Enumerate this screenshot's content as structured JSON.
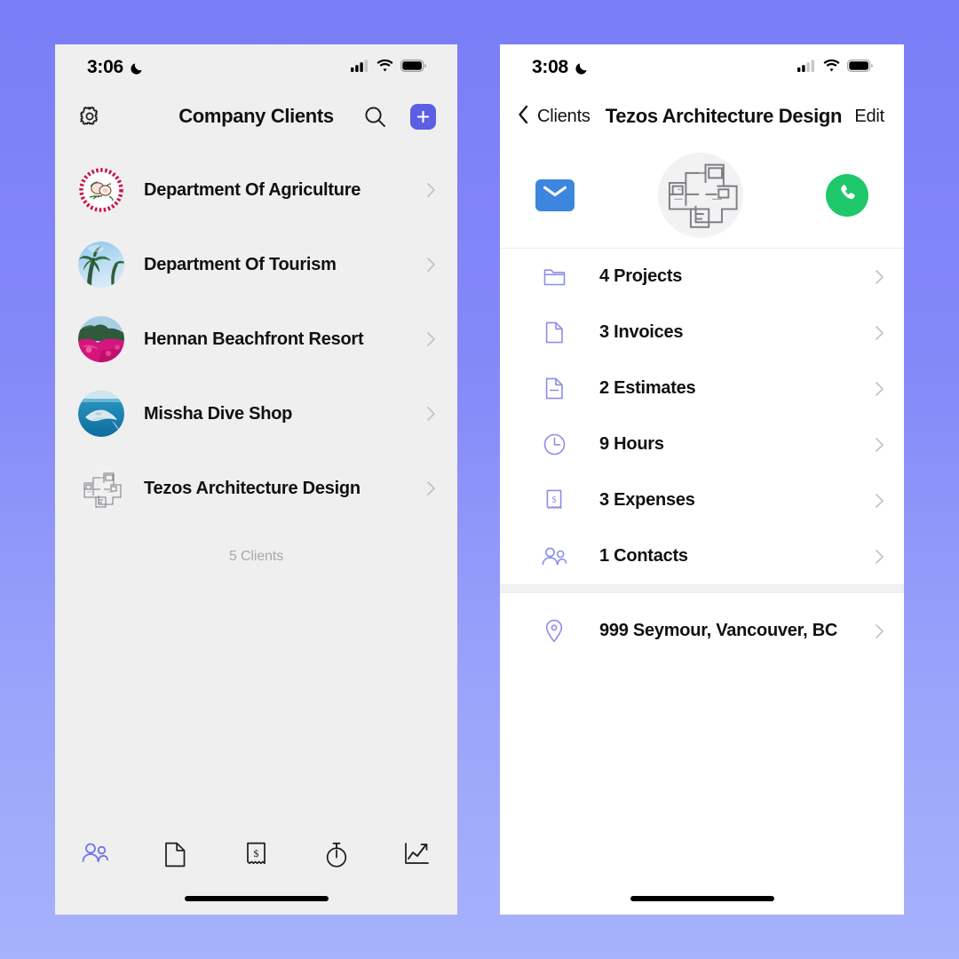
{
  "background": {
    "gradient_top": "#7a7ef7",
    "gradient_bottom": "#a6b2fb"
  },
  "left_phone": {
    "status_bar": {
      "time": "3:06",
      "moon_icon": "crescent-moon-icon",
      "signal_icon": "cellular-signal-icon",
      "wifi_icon": "wifi-icon",
      "battery_icon": "battery-full-icon"
    },
    "nav": {
      "settings_icon": "gear-icon",
      "title": "Company Clients",
      "search_icon": "search-icon",
      "add_label": "+",
      "add_icon": "plus-icon"
    },
    "clients": [
      {
        "name": "Department Of Agriculture",
        "avatar": "agriculture-seal-logo",
        "chevron": "chevron-right-icon"
      },
      {
        "name": "Department Of Tourism",
        "avatar": "palm-tree-photo",
        "chevron": "chevron-right-icon"
      },
      {
        "name": "Hennan Beachfront Resort",
        "avatar": "pink-flowers-photo",
        "chevron": "chevron-right-icon"
      },
      {
        "name": "Missha Dive Shop",
        "avatar": "manta-ray-photo",
        "chevron": "chevron-right-icon"
      },
      {
        "name": "Tezos Architecture Design",
        "avatar": "floorplan-drawing",
        "chevron": "chevron-right-icon"
      }
    ],
    "footer_count": "5 Clients",
    "tabs": [
      {
        "name": "clients",
        "icon": "people-icon",
        "active": true
      },
      {
        "name": "documents",
        "icon": "document-icon",
        "active": false
      },
      {
        "name": "expenses",
        "icon": "receipt-dollar-icon",
        "active": false
      },
      {
        "name": "time",
        "icon": "stopwatch-icon",
        "active": false
      },
      {
        "name": "reports",
        "icon": "chart-line-icon",
        "active": false
      }
    ],
    "accent_color": "#5b5fe3",
    "tab_active_color": "#6f74e8"
  },
  "right_phone": {
    "status_bar": {
      "time": "3:08",
      "moon_icon": "crescent-moon-icon",
      "signal_icon": "cellular-signal-icon",
      "wifi_icon": "wifi-icon",
      "battery_icon": "battery-full-icon"
    },
    "nav": {
      "back_icon": "chevron-left-icon",
      "back_label": "Clients",
      "title": "Tezos Architecture Design",
      "edit_label": "Edit"
    },
    "hero": {
      "mail_icon": "envelope-icon",
      "mail_color": "#3d86dd",
      "avatar": "floorplan-drawing",
      "call_icon": "phone-icon",
      "call_color": "#1ec86a"
    },
    "detail_rows": [
      {
        "label": "4 Projects",
        "icon": "folder-icon",
        "chevron": "chevron-right-icon"
      },
      {
        "label": "3 Invoices",
        "icon": "document-icon",
        "chevron": "chevron-right-icon"
      },
      {
        "label": "2 Estimates",
        "icon": "estimate-document-icon",
        "chevron": "chevron-right-icon"
      },
      {
        "label": "9 Hours",
        "icon": "clock-icon",
        "chevron": "chevron-right-icon"
      },
      {
        "label": "3 Expenses",
        "icon": "receipt-dollar-icon",
        "chevron": "chevron-right-icon"
      },
      {
        "label": "1 Contacts",
        "icon": "people-icon",
        "chevron": "chevron-right-icon"
      }
    ],
    "address_row": {
      "label": "999 Seymour, Vancouver, BC",
      "icon": "map-pin-icon",
      "chevron": "chevron-right-icon"
    },
    "icon_color": "#8b8ee8"
  }
}
